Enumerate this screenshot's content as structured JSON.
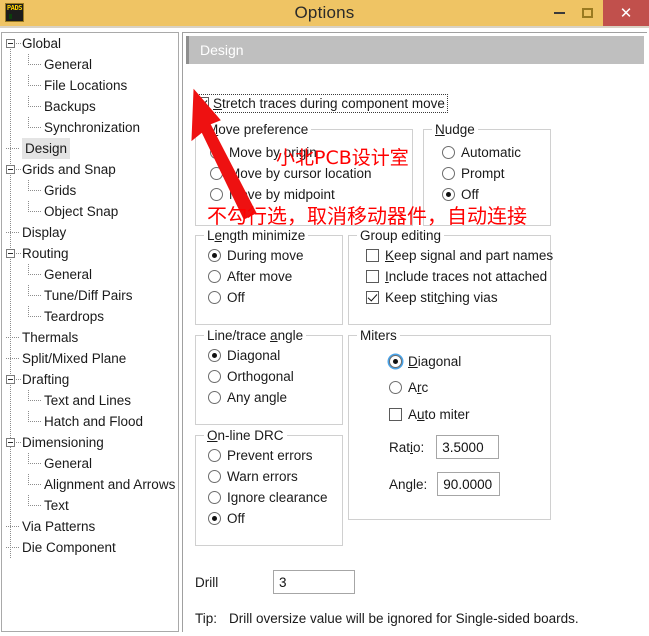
{
  "window": {
    "title": "Options",
    "icon": "pads-app-icon",
    "icon_text": "PADS",
    "minimize_label": "–",
    "maximize_label": "☐",
    "close_label": "✕"
  },
  "sidebar": {
    "items": [
      {
        "label": "Global",
        "level": 0,
        "expander": true,
        "selected": false
      },
      {
        "label": "General",
        "level": 1,
        "expander": false,
        "selected": false
      },
      {
        "label": "File Locations",
        "level": 1,
        "expander": false,
        "selected": false
      },
      {
        "label": "Backups",
        "level": 1,
        "expander": false,
        "selected": false
      },
      {
        "label": "Synchronization",
        "level": 1,
        "expander": false,
        "selected": false
      },
      {
        "label": "Design",
        "level": 0,
        "expander": false,
        "selected": true
      },
      {
        "label": "Grids and Snap",
        "level": 0,
        "expander": true,
        "selected": false
      },
      {
        "label": "Grids",
        "level": 1,
        "expander": false,
        "selected": false
      },
      {
        "label": "Object Snap",
        "level": 1,
        "expander": false,
        "selected": false
      },
      {
        "label": "Display",
        "level": 0,
        "expander": false,
        "selected": false
      },
      {
        "label": "Routing",
        "level": 0,
        "expander": true,
        "selected": false
      },
      {
        "label": "General",
        "level": 1,
        "expander": false,
        "selected": false
      },
      {
        "label": "Tune/Diff Pairs",
        "level": 1,
        "expander": false,
        "selected": false
      },
      {
        "label": "Teardrops",
        "level": 1,
        "expander": false,
        "selected": false
      },
      {
        "label": "Thermals",
        "level": 0,
        "expander": false,
        "selected": false
      },
      {
        "label": "Split/Mixed Plane",
        "level": 0,
        "expander": false,
        "selected": false
      },
      {
        "label": "Drafting",
        "level": 0,
        "expander": true,
        "selected": false
      },
      {
        "label": "Text and Lines",
        "level": 1,
        "expander": false,
        "selected": false
      },
      {
        "label": "Hatch and Flood",
        "level": 1,
        "expander": false,
        "selected": false
      },
      {
        "label": "Dimensioning",
        "level": 0,
        "expander": true,
        "selected": false
      },
      {
        "label": "General",
        "level": 1,
        "expander": false,
        "selected": false
      },
      {
        "label": "Alignment and Arrows",
        "level": 1,
        "expander": false,
        "selected": false
      },
      {
        "label": "Text",
        "level": 1,
        "expander": false,
        "selected": false
      },
      {
        "label": "Via Patterns",
        "level": 0,
        "expander": false,
        "selected": false
      },
      {
        "label": "Die Component",
        "level": 0,
        "expander": false,
        "selected": false
      }
    ]
  },
  "main": {
    "section_title": "Design",
    "stretch_traces": {
      "label": "Stretch traces during component move",
      "checked": true,
      "focused": true
    },
    "move_preference": {
      "caption": "Move preference",
      "options": [
        {
          "label": "Move by origin",
          "selected": true
        },
        {
          "label": "Move by cursor location",
          "selected": false
        },
        {
          "label": "Move by midpoint",
          "selected": false
        }
      ]
    },
    "nudge": {
      "caption": "Nudge",
      "options": [
        {
          "label": "Automatic",
          "selected": false
        },
        {
          "label": "Prompt",
          "selected": false
        },
        {
          "label": "Off",
          "selected": true
        }
      ]
    },
    "length_minimize": {
      "caption": "Length minimize",
      "options": [
        {
          "label": "During move",
          "selected": true
        },
        {
          "label": "After move",
          "selected": false
        },
        {
          "label": "Off",
          "selected": false
        }
      ]
    },
    "group_editing": {
      "caption": "Group editing",
      "options": [
        {
          "label": "Keep signal and part names",
          "checked": false
        },
        {
          "label": "Include traces not attached",
          "checked": false
        },
        {
          "label": "Keep stitching vias",
          "checked": true
        }
      ]
    },
    "line_trace_angle": {
      "caption": "Line/trace angle",
      "options": [
        {
          "label": "Diagonal",
          "selected": true
        },
        {
          "label": "Orthogonal",
          "selected": false
        },
        {
          "label": "Any angle",
          "selected": false
        }
      ]
    },
    "miters": {
      "caption": "Miters",
      "options": [
        {
          "label": "Diagonal",
          "selected": true,
          "focused": true
        },
        {
          "label": "Arc",
          "selected": false,
          "focused": false
        }
      ],
      "auto_miter": {
        "label": "Auto miter",
        "checked": false
      },
      "ratio": {
        "label": "Ratio:",
        "value": "3.5000"
      },
      "angle": {
        "label": "Angle:",
        "value": "90.0000"
      }
    },
    "online_drc": {
      "caption": "On-line DRC",
      "options": [
        {
          "label": "Prevent errors",
          "selected": false
        },
        {
          "label": "Warn errors",
          "selected": false
        },
        {
          "label": "Ignore clearance",
          "selected": false
        },
        {
          "label": "Off",
          "selected": true
        }
      ]
    },
    "drill": {
      "label": "Drill",
      "value": "3"
    },
    "tip": {
      "label": "Tip:",
      "text": "Drill oversize value will be ignored for Single-sided boards."
    }
  },
  "annotations": {
    "watermark": "小北PCB设计室",
    "note": "不勾行选，取消移动器件，自动连接",
    "arrow_color": "#ee1111"
  },
  "colors": {
    "titlebar": "#efc464",
    "close_button": "#c1504c",
    "section_header": "#bfbfbf",
    "selection": "#e4e4e4",
    "focus_ring": "#4aa3e8",
    "annotation_red": "#ff0000"
  }
}
